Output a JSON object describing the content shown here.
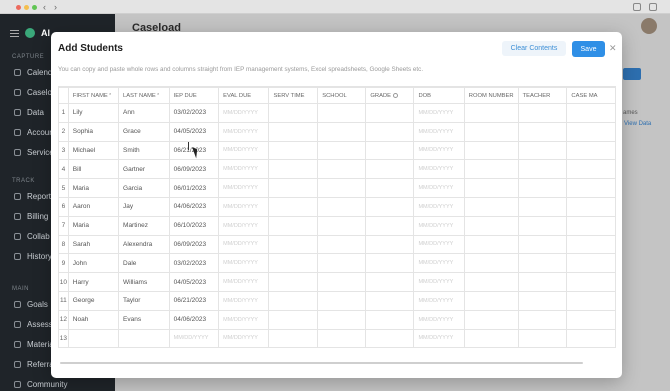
{
  "background": {
    "title": "Caseload",
    "brand": "Al",
    "sidebar": {
      "sections": [
        {
          "label": "CAPTURE",
          "items": [
            "Calendar",
            "Caseload",
            "Data",
            "Accounts",
            "Services"
          ]
        },
        {
          "label": "TRACK",
          "items": [
            "Reports",
            "Billing",
            "Collab",
            "History"
          ]
        },
        {
          "label": "MAIN",
          "items": [
            "Goals",
            "Assess",
            "Materials",
            "Referrals",
            "Community"
          ]
        }
      ]
    },
    "side_text": "View Data",
    "side_label": "ames"
  },
  "modal": {
    "title": "Add Students",
    "description": "You can copy and paste whole rows and columns straight from IEP management systems, Excel spreadsheets, Google Sheets etc.",
    "clear_label": "Clear Contents",
    "save_label": "Save",
    "close_icon": "close-icon",
    "accent": "#2f8fe6",
    "columns": [
      "FIRST NAME",
      "LAST NAME",
      "IEP DUE",
      "EVAL DUE",
      "SERV TIME",
      "SCHOOL",
      "GRADE",
      "DOB",
      "ROOM NUMBER",
      "TEACHER",
      "CASE MA"
    ],
    "required_columns": [
      "FIRST NAME",
      "LAST NAME"
    ],
    "date_placeholder": "MM/DD/YYYY",
    "rows": [
      {
        "n": "1",
        "first": "Lily",
        "last": "Ann",
        "iep": "03/02/2023"
      },
      {
        "n": "2",
        "first": "Sophia",
        "last": "Grace",
        "iep": "04/05/2023"
      },
      {
        "n": "3",
        "first": "Michael",
        "last": "Smith",
        "iep": "06/21/2023"
      },
      {
        "n": "4",
        "first": "Bill",
        "last": "Gartner",
        "iep": "06/09/2023"
      },
      {
        "n": "5",
        "first": "Maria",
        "last": "Garcia",
        "iep": "06/01/2023"
      },
      {
        "n": "6",
        "first": "Aaron",
        "last": "Jay",
        "iep": "04/06/2023"
      },
      {
        "n": "7",
        "first": "Maria",
        "last": "Martinez",
        "iep": "06/10/2023"
      },
      {
        "n": "8",
        "first": "Sarah",
        "last": "Alexendra",
        "iep": "06/09/2023"
      },
      {
        "n": "9",
        "first": "John",
        "last": "Dale",
        "iep": "03/02/2023"
      },
      {
        "n": "10",
        "first": "Harry",
        "last": "Williams",
        "iep": "04/05/2023"
      },
      {
        "n": "11",
        "first": "George",
        "last": "Taylor",
        "iep": "06/21/2023"
      },
      {
        "n": "12",
        "first": "Noah",
        "last": "Evans",
        "iep": "04/06/2023"
      },
      {
        "n": "13",
        "first": "",
        "last": "",
        "iep": ""
      }
    ]
  }
}
